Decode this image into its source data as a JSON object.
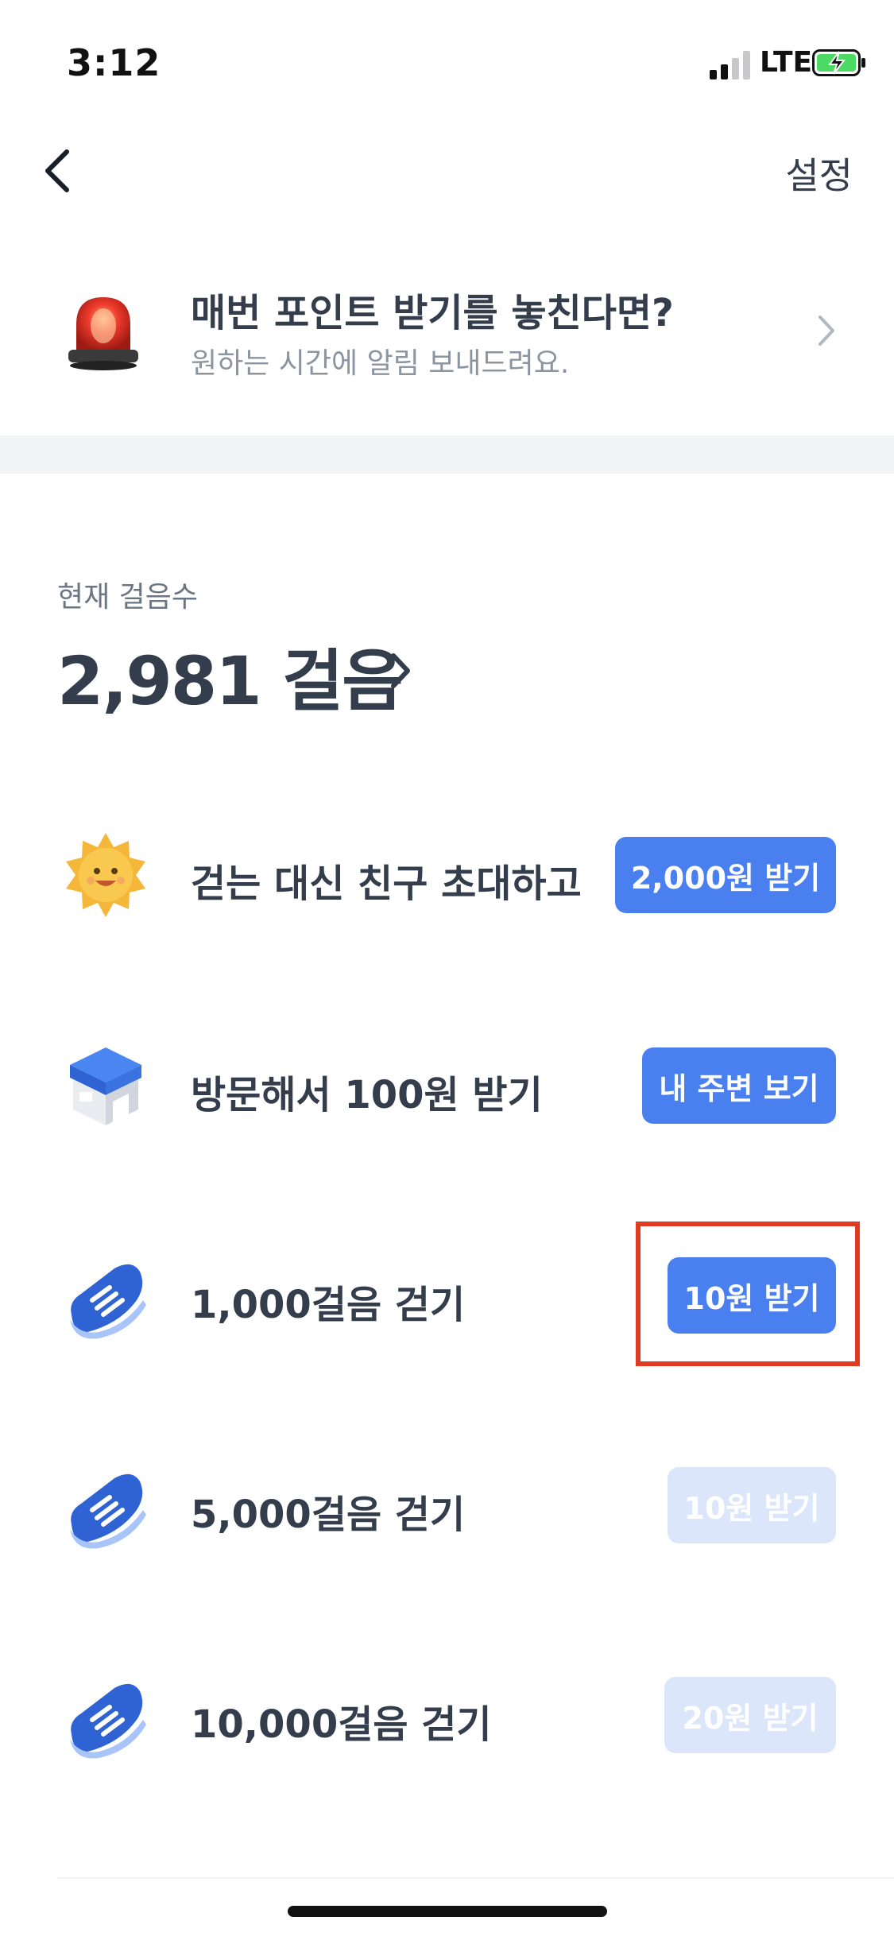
{
  "status_bar": {
    "time": "3:12",
    "network": "LTE"
  },
  "nav": {
    "settings_label": "설정"
  },
  "banner": {
    "title": "매번 포인트 받기를 놓친다면?",
    "subtitle": "원하는 시간에 알림 보내드려요."
  },
  "steps": {
    "label": "현재 걸음수",
    "value": "2,981 걸음"
  },
  "rows": [
    {
      "icon": "sun-icon",
      "text": "걷는 대신 친구 초대하고",
      "button": "2,000원 받기",
      "enabled": true
    },
    {
      "icon": "store-icon",
      "text": "방문해서 100원 받기",
      "button": "내 주변 보기",
      "enabled": true
    },
    {
      "icon": "sneaker-icon",
      "text": "1,000걸음 걷기",
      "button": "10원 받기",
      "enabled": true
    },
    {
      "icon": "sneaker-icon",
      "text": "5,000걸음 걷기",
      "button": "10원 받기",
      "enabled": false
    },
    {
      "icon": "sneaker-icon",
      "text": "10,000걸음 걷기",
      "button": "20원 받기",
      "enabled": false
    }
  ],
  "colors": {
    "accent": "#4a7ff0",
    "disabled": "#dbe6fb",
    "highlight": "#e03a23"
  }
}
